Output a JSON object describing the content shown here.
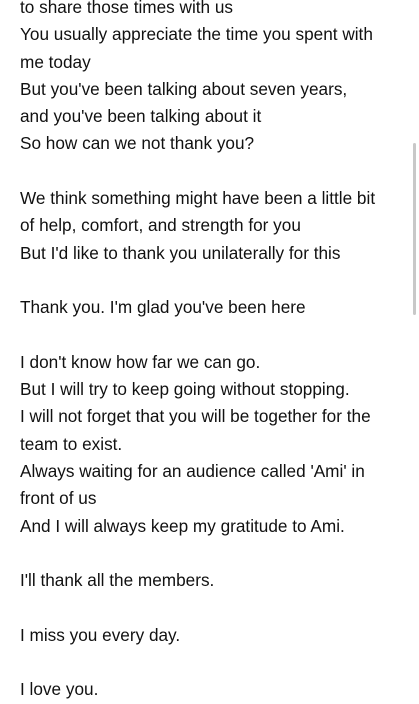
{
  "text": {
    "lines": [
      "to share those times with us",
      "You usually appreciate the time you spent with",
      "me today",
      "But you've been talking about seven years,",
      "and you've been talking about it",
      "So how can we not thank you?",
      "",
      "We think something might have been a little bit",
      "of help, comfort, and strength for you",
      "But I'd like to thank you unilaterally for this",
      "",
      "Thank you. I'm glad you've been here",
      "",
      "I don't know how far we can go.",
      "But I will try to keep going without stopping.",
      "I will not forget that you will be together for the",
      "team to exist.",
      "Always waiting for an audience called 'Ami' in",
      "front of us",
      "And I will always keep my gratitude to Ami.",
      "",
      "I'll thank all the members.",
      "",
      "I miss you every day.",
      "",
      "I love you."
    ]
  }
}
